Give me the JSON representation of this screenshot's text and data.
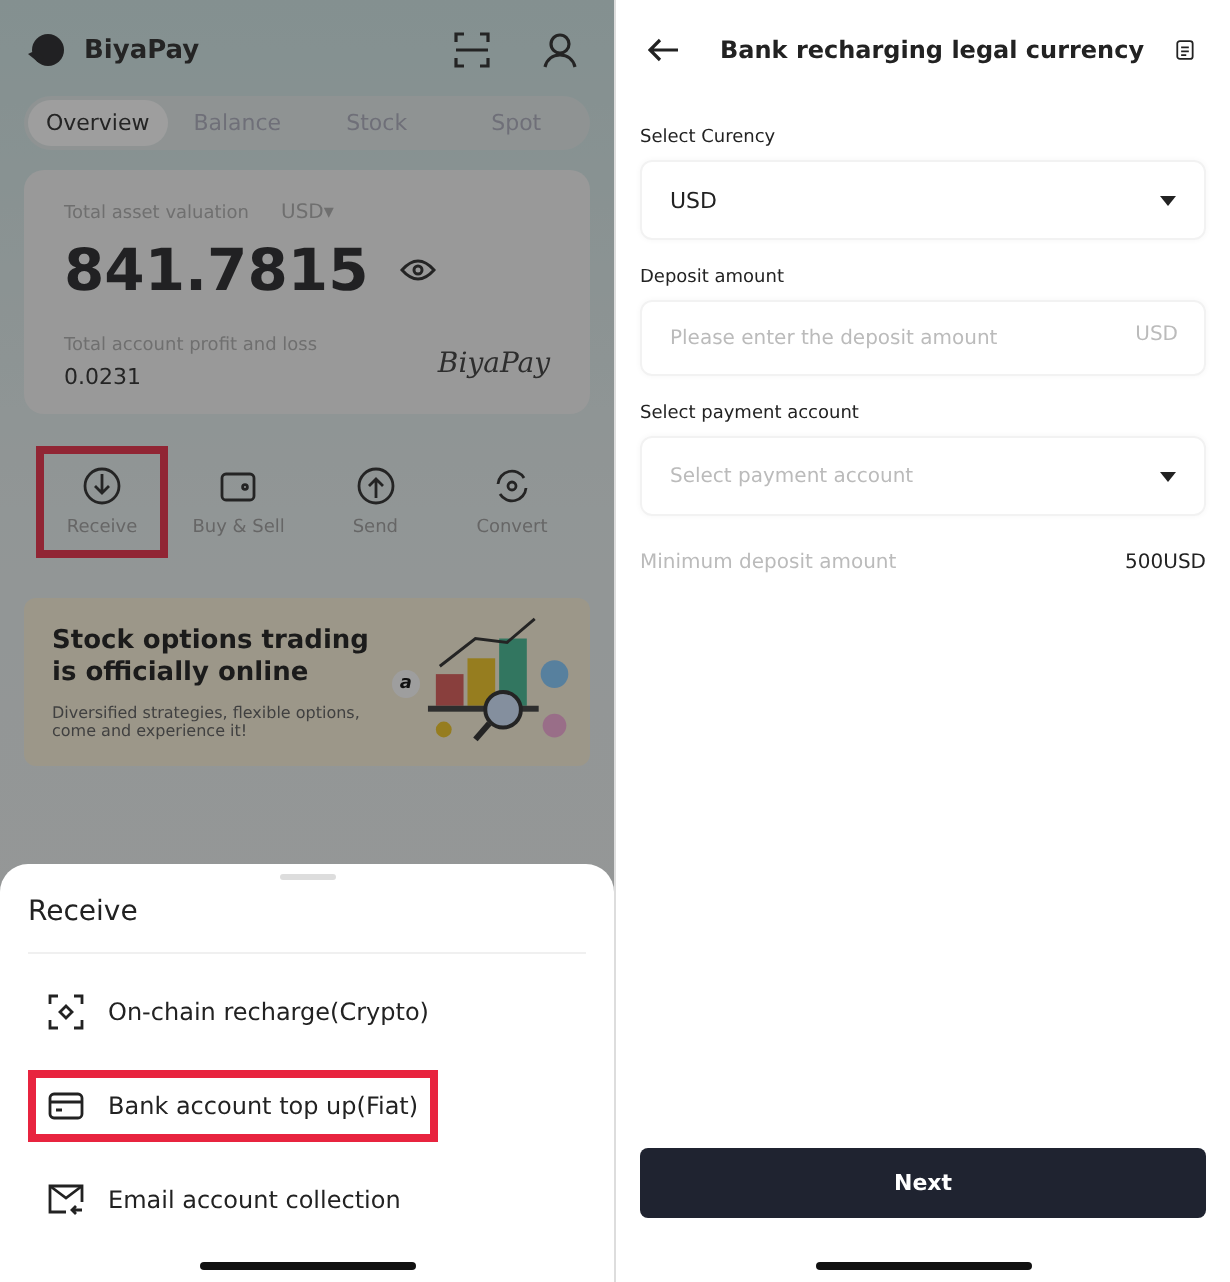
{
  "left": {
    "brand": "BiyaPay",
    "tabs": [
      {
        "label": "Overview",
        "selected": true
      },
      {
        "label": "Balance",
        "selected": false
      },
      {
        "label": "Stock",
        "selected": false
      },
      {
        "label": "Spot",
        "selected": false
      }
    ],
    "asset": {
      "label": "Total asset valuation",
      "currency": "USD▾",
      "value": "841.7815",
      "pnl_label": "Total account profit and loss",
      "pnl": "0.0231",
      "signature": "BiyaPay"
    },
    "actions": [
      {
        "label": "Receive",
        "highlighted": true
      },
      {
        "label": "Buy & Sell",
        "highlighted": false
      },
      {
        "label": "Send",
        "highlighted": false
      },
      {
        "label": "Convert",
        "highlighted": false
      }
    ],
    "banner": {
      "title_lines": [
        "Stock options trading",
        " is officially online"
      ],
      "description": "Diversified strategies, flexible options, come and experience it!",
      "badge": "a"
    },
    "sheet": {
      "title": "Receive",
      "items": [
        {
          "label": "On-chain recharge(Crypto)",
          "highlighted": false
        },
        {
          "label": "Bank account top up(Fiat)",
          "highlighted": true
        },
        {
          "label": "Email account collection",
          "highlighted": false
        }
      ]
    }
  },
  "right": {
    "title": "Bank recharging legal currency",
    "fields": [
      {
        "kind": "select",
        "label": "Select Curency",
        "value": "USD"
      },
      {
        "kind": "input",
        "label": "Deposit amount",
        "placeholder": "Please enter the deposit amount",
        "suffix": "USD"
      },
      {
        "kind": "select",
        "label": "Select payment account",
        "placeholder": "Select payment account"
      }
    ],
    "minimum": {
      "label": "Minimum deposit amount",
      "value": "500USD"
    },
    "button": "Next"
  }
}
